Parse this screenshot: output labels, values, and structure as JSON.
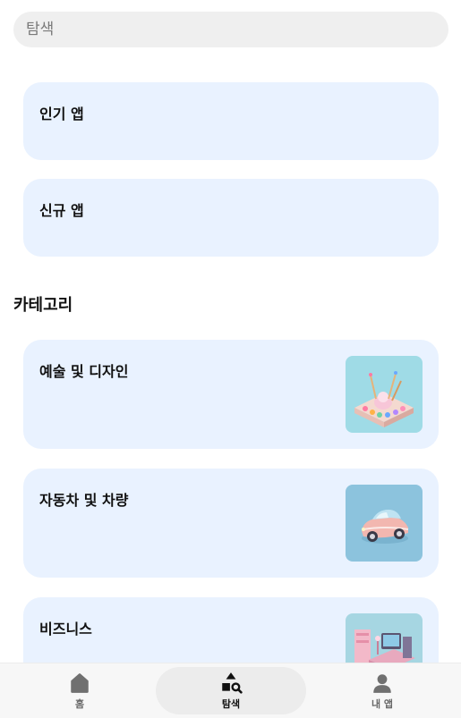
{
  "search": {
    "placeholder": "탐색",
    "value": ""
  },
  "featured": [
    {
      "title": "인기 앱"
    },
    {
      "title": "신규 앱"
    }
  ],
  "categories_section": {
    "title": "카테고리",
    "items": [
      {
        "title": "예술 및 디자인",
        "image": "art-palette-illustration",
        "image_bg": "#9fdbe6"
      },
      {
        "title": "자동차 및 차량",
        "image": "car-illustration",
        "image_bg": "#8cc3dd"
      },
      {
        "title": "비즈니스",
        "image": "office-desk-illustration",
        "image_bg": "#a6d6e2"
      }
    ]
  },
  "bottom_nav": {
    "items": [
      {
        "label": "홈",
        "icon": "home-icon",
        "active": false
      },
      {
        "label": "탐색",
        "icon": "explore-shapes-icon",
        "active": true
      },
      {
        "label": "내 앱",
        "icon": "person-icon",
        "active": false
      }
    ]
  },
  "colors": {
    "card_bg": "#e9f2ff",
    "search_bg": "#efefef",
    "nav_active_bg": "#ececec"
  }
}
